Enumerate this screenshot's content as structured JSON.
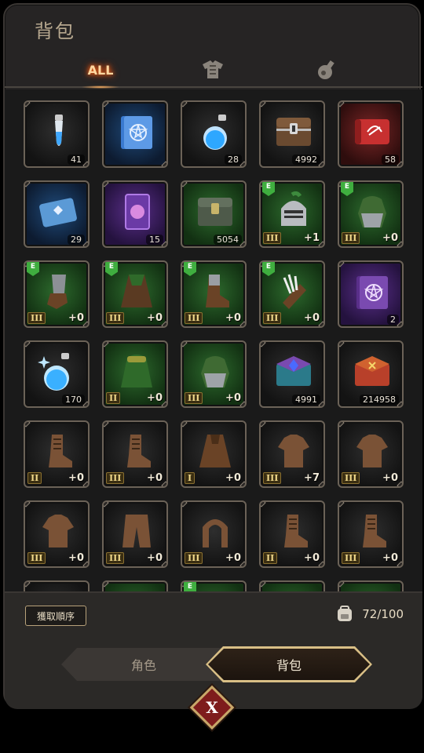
{
  "title": "背包",
  "tabs": [
    {
      "label": "ALL",
      "active": true
    },
    {
      "icon": "armor-icon"
    },
    {
      "icon": "potion-icon"
    }
  ],
  "items": [
    {
      "icon": "vial-potion-icon",
      "rarity": "gray",
      "count": "41"
    },
    {
      "icon": "pentagram-book-icon",
      "rarity": "blue",
      "count": ""
    },
    {
      "icon": "blue-potion-icon",
      "rarity": "gray",
      "count": "28"
    },
    {
      "icon": "wooden-chest-icon",
      "rarity": "gray",
      "count": "4992"
    },
    {
      "icon": "red-scroll-icon",
      "rarity": "red",
      "count": "58"
    },
    {
      "icon": "blue-scroll-icon",
      "rarity": "blue",
      "count": "29"
    },
    {
      "icon": "purple-card-icon",
      "rarity": "purple",
      "count": "15"
    },
    {
      "icon": "green-chest-icon",
      "rarity": "green",
      "count": "5054"
    },
    {
      "icon": "helmet-icon",
      "rarity": "green",
      "badge": "E",
      "tier": "III",
      "plus": "+1"
    },
    {
      "icon": "shoulder-armor-icon",
      "rarity": "green",
      "badge": "E",
      "tier": "III",
      "plus": "+0"
    },
    {
      "icon": "gauntlet-icon",
      "rarity": "green",
      "badge": "E",
      "tier": "III",
      "plus": "+0"
    },
    {
      "icon": "cloak-icon",
      "rarity": "green",
      "badge": "E",
      "tier": "III",
      "plus": "+0"
    },
    {
      "icon": "boot-icon",
      "rarity": "green",
      "badge": "E",
      "tier": "III",
      "plus": "+0"
    },
    {
      "icon": "quiver-icon",
      "rarity": "green",
      "badge": "E",
      "tier": "III",
      "plus": "+0"
    },
    {
      "icon": "purple-book-icon",
      "rarity": "purple",
      "count": "2"
    },
    {
      "icon": "sparkle-potion-icon",
      "rarity": "gray",
      "count": "170"
    },
    {
      "icon": "hood-icon",
      "rarity": "green",
      "tier": "II",
      "plus": "+0"
    },
    {
      "icon": "shoulder-armor-icon",
      "rarity": "green",
      "tier": "III",
      "plus": "+0"
    },
    {
      "icon": "magic-chest-icon",
      "rarity": "gray",
      "count": "4991"
    },
    {
      "icon": "red-chest-icon",
      "rarity": "gray",
      "count": "214958"
    },
    {
      "icon": "leather-boot-icon",
      "rarity": "gray",
      "tier": "II",
      "plus": "+0"
    },
    {
      "icon": "leather-boot-icon",
      "rarity": "gray",
      "tier": "III",
      "plus": "+0"
    },
    {
      "icon": "leather-cloak-icon",
      "rarity": "gray",
      "tier": "I",
      "plus": "+0"
    },
    {
      "icon": "leather-shirt-icon",
      "rarity": "gray",
      "tier": "III",
      "plus": "+7"
    },
    {
      "icon": "leather-shirt-icon",
      "rarity": "gray",
      "tier": "III",
      "plus": "+0"
    },
    {
      "icon": "leather-shirt-icon",
      "rarity": "gray",
      "tier": "III",
      "plus": "+0"
    },
    {
      "icon": "leather-pants-icon",
      "rarity": "gray",
      "tier": "III",
      "plus": "+0"
    },
    {
      "icon": "leather-hood-icon",
      "rarity": "gray",
      "tier": "III",
      "plus": "+0"
    },
    {
      "icon": "leather-boot-icon",
      "rarity": "gray",
      "tier": "II",
      "plus": "+0"
    },
    {
      "icon": "leather-boot-icon",
      "rarity": "gray",
      "tier": "III",
      "plus": "+0"
    },
    {
      "icon": "partial-item-icon",
      "rarity": "gray"
    },
    {
      "icon": "partial-item-icon",
      "rarity": "green"
    },
    {
      "icon": "partial-item-icon",
      "rarity": "green",
      "badge": "E"
    },
    {
      "icon": "partial-item-icon",
      "rarity": "green"
    },
    {
      "icon": "partial-item-icon",
      "rarity": "green"
    }
  ],
  "sort_button": "獲取順序",
  "capacity": "72/100",
  "nav": {
    "role": "角色",
    "bag": "背包"
  },
  "close": "X",
  "colors": {
    "accent": "#ffd7a0",
    "gold_border": "#d9bf86",
    "close_red": "#7e1c1c"
  }
}
